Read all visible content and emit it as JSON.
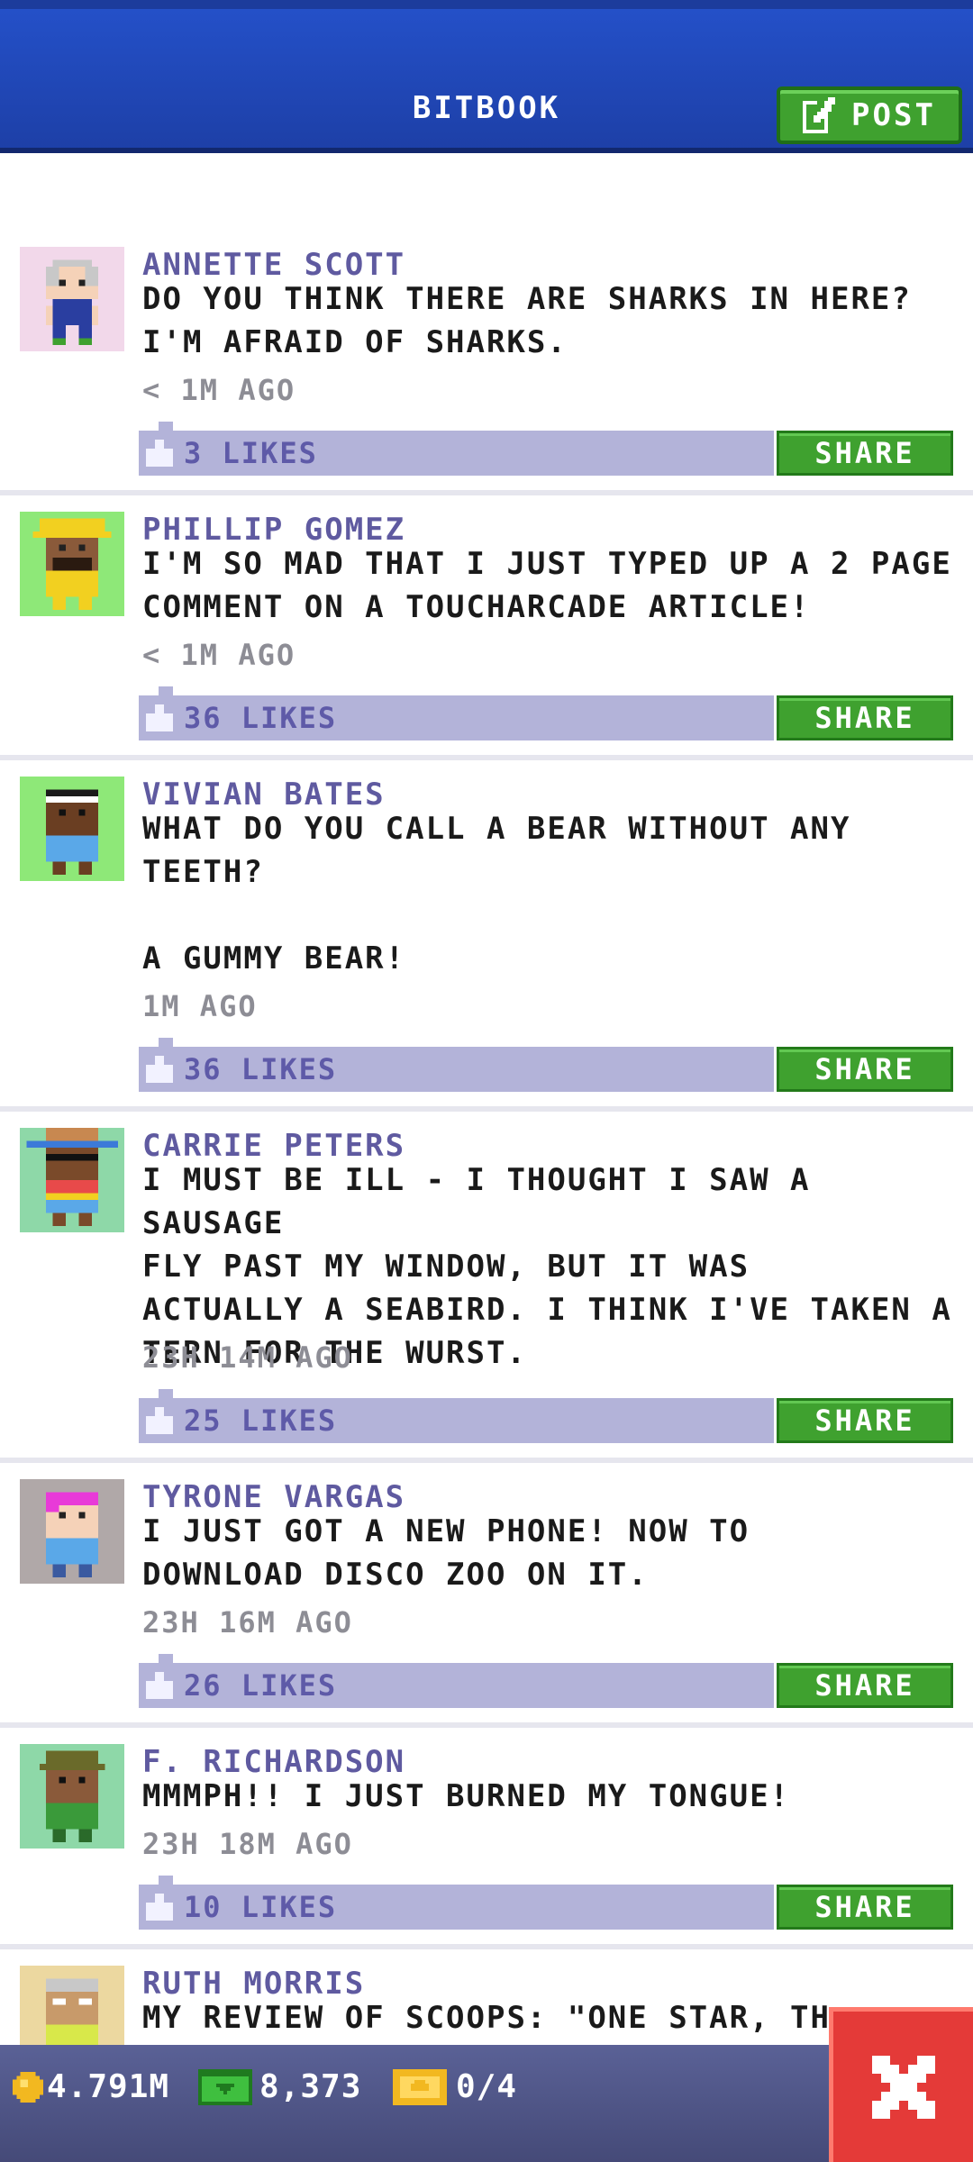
{
  "header": {
    "title": "BITBOOK",
    "post_label": "POST"
  },
  "posts": [
    {
      "author": "ANNETTE SCOTT",
      "text": "DO YOU THINK THERE ARE SHARKS IN HERE?\nI'M AFRAID OF SHARKS.",
      "time": "< 1M AGO",
      "likes": "3 LIKES",
      "share": "SHARE"
    },
    {
      "author": "PHILLIP GOMEZ",
      "text": "I'M SO MAD THAT I JUST TYPED UP A 2 PAGE\nCOMMENT ON A TOUCHARCADE ARTICLE!",
      "time": "< 1M AGO",
      "likes": "36 LIKES",
      "share": "SHARE"
    },
    {
      "author": "VIVIAN BATES",
      "text": "WHAT DO YOU CALL A BEAR WITHOUT ANY\nTEETH?\n\nA GUMMY BEAR!",
      "time": "1M AGO",
      "likes": "36 LIKES",
      "share": "SHARE"
    },
    {
      "author": "CARRIE PETERS",
      "text": "I MUST BE ILL - I THOUGHT I SAW A SAUSAGE\nFLY PAST MY WINDOW, BUT IT WAS\nACTUALLY A SEABIRD. I THINK I'VE TAKEN A\nTERN FOR THE WURST.",
      "time": "23H 14M AGO",
      "likes": "25 LIKES",
      "share": "SHARE"
    },
    {
      "author": "TYRONE VARGAS",
      "text": "I JUST GOT A NEW PHONE! NOW TO\nDOWNLOAD DISCO ZOO ON IT.",
      "time": "23H 16M AGO",
      "likes": "26 LIKES",
      "share": "SHARE"
    },
    {
      "author": "F. RICHARDSON",
      "text": "MMMPH!! I JUST BURNED MY TONGUE!",
      "time": "23H 18M AGO",
      "likes": "10 LIKES",
      "share": "SHARE"
    },
    {
      "author": "RUTH MORRIS",
      "text": "MY REVIEW OF SCOOPS: \"ONE STAR, TH",
      "time": "",
      "likes": "",
      "share": ""
    }
  ],
  "bottom_bar": {
    "coins": "4.791M",
    "cash": "8,373",
    "tickets": "0/4"
  },
  "icons": {
    "post": "edit-icon",
    "like": "thumb-icon",
    "coins": "coin-icon",
    "cash": "cash-icon",
    "tickets": "ticket-icon",
    "close": "close-icon"
  },
  "colors": {
    "header": "#2450c8",
    "accent_green": "#3fa12f",
    "likes_bar": "#b3b3d9",
    "author": "#5f5aa0",
    "close": "#e43a38"
  }
}
